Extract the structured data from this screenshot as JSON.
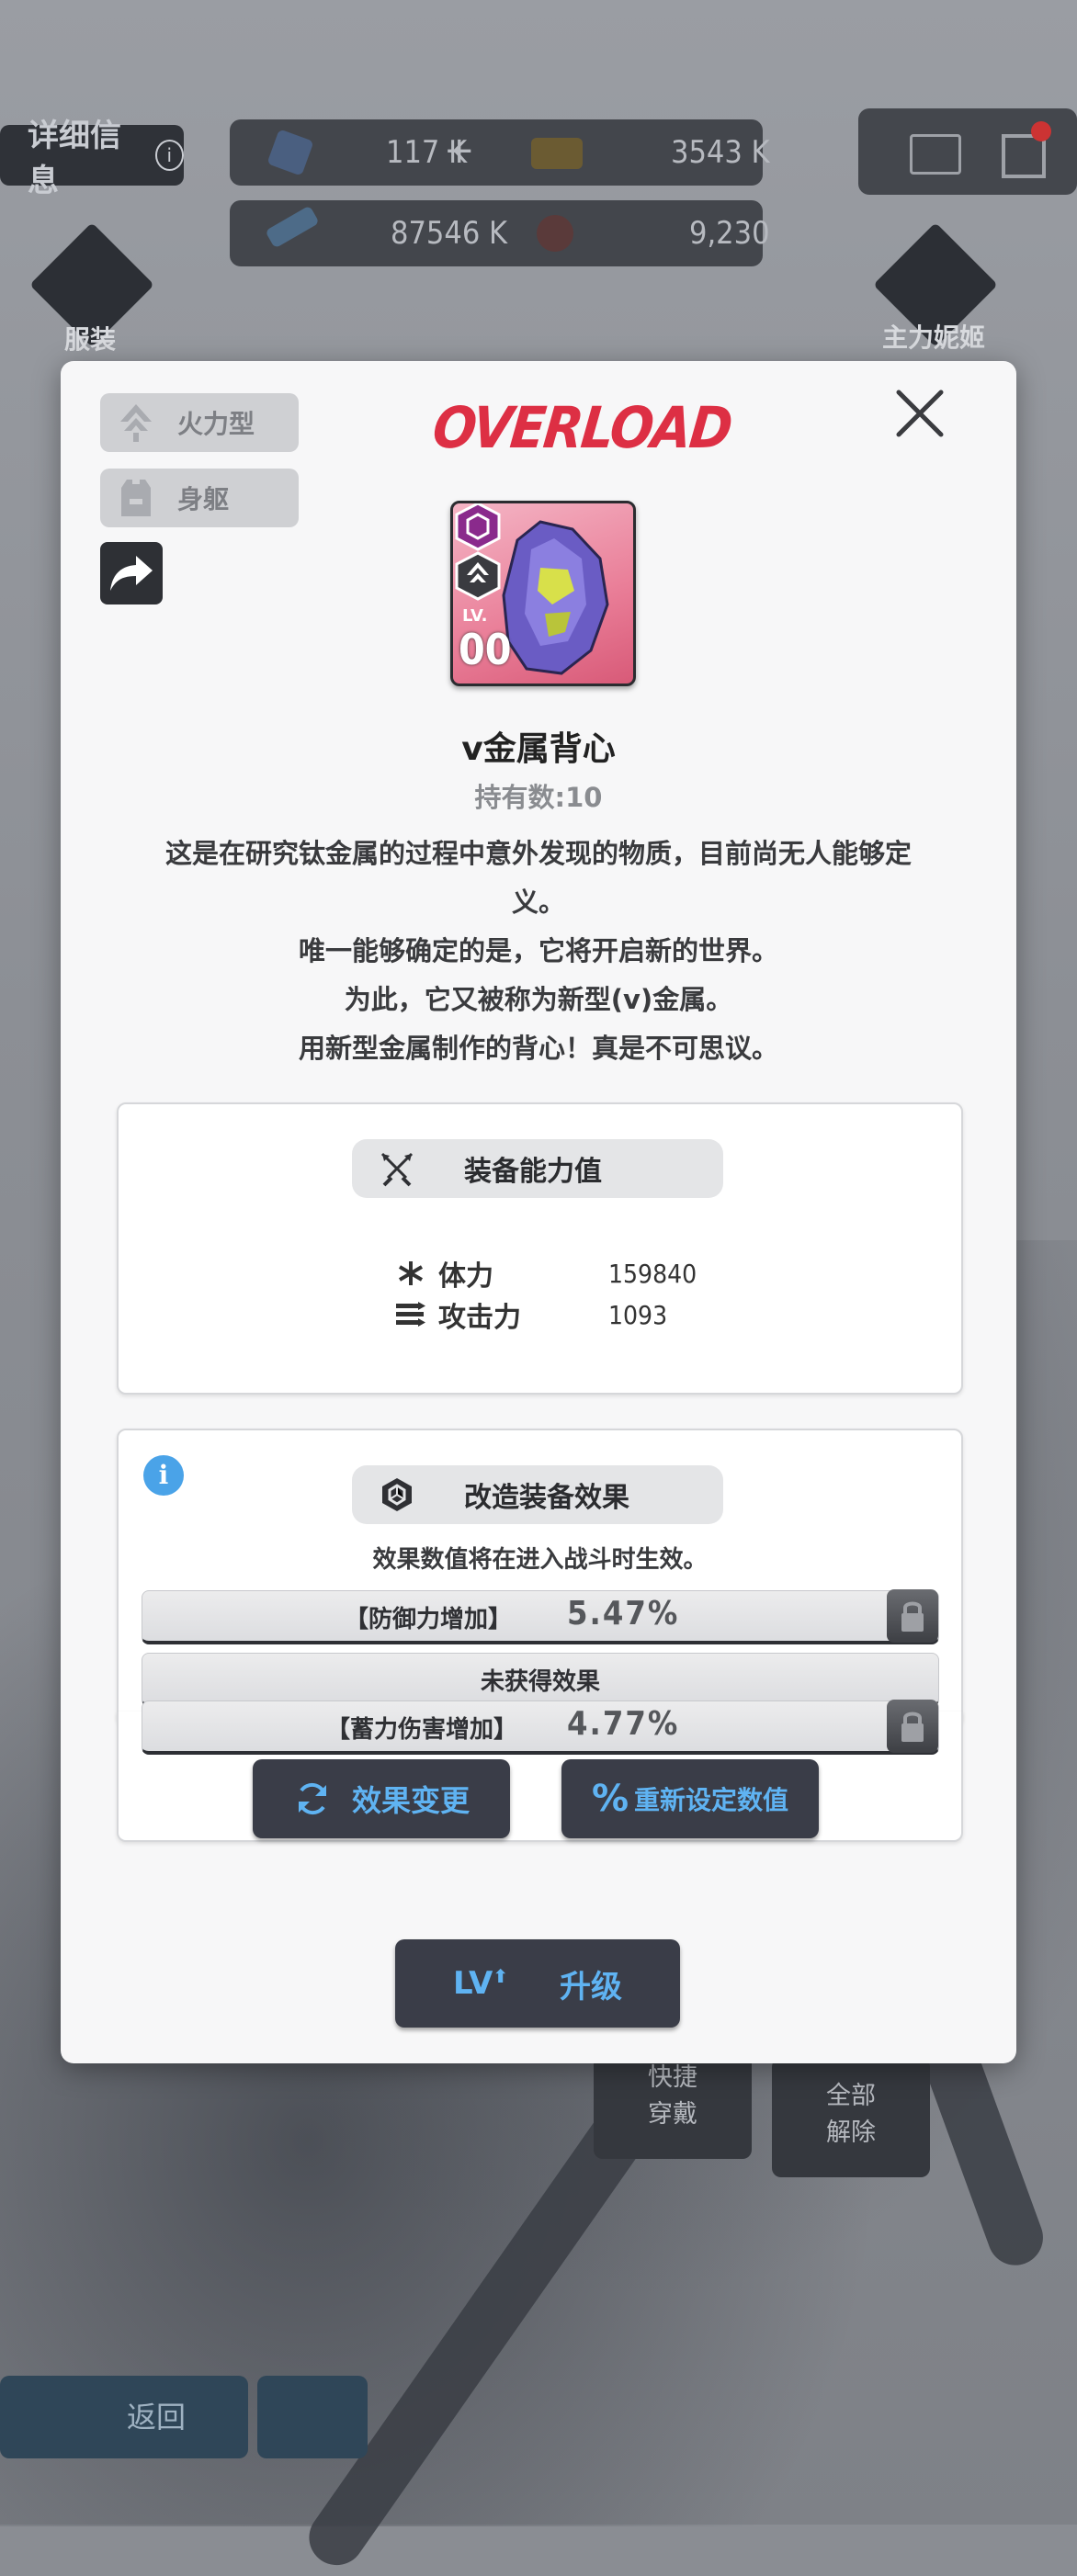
{
  "background": {
    "detail_info": "详细信息",
    "resources": [
      {
        "name": "diamond",
        "value": "117 K"
      },
      {
        "name": "card",
        "value": "3543 K"
      },
      {
        "name": "battery",
        "value": "87546 K"
      },
      {
        "name": "orb",
        "value": "9,230"
      }
    ],
    "costume_label": "服装",
    "main_nikke_label": "主力妮姬",
    "quick_equip": "快捷\n穿戴",
    "remove_all": "全部\n解除",
    "back_label": "返回"
  },
  "modal": {
    "chips": [
      {
        "label": "火力型",
        "icon": "firepower-icon"
      },
      {
        "label": "身躯",
        "icon": "body-armor-icon"
      }
    ],
    "logo": "OVERLOAD",
    "item": {
      "level_prefix": "LV.",
      "level": "00",
      "name": "v金属背心",
      "count": "持有数:10",
      "description": [
        "这是在研究钛金属的过程中意外发现的物质，目前尚无人能够定",
        "义。",
        "唯一能够确定的是，它将开启新的世界。",
        "为此，它又被称为新型(v)金属。",
        "用新型金属制作的背心！真是不可思议。"
      ]
    },
    "stats_panel": {
      "title": "装备能力值",
      "stats": [
        {
          "label": "体力",
          "value": "159840",
          "icon": "hp-icon"
        },
        {
          "label": "攻击力",
          "value": "1093",
          "icon": "attack-icon"
        }
      ]
    },
    "effects_panel": {
      "title": "改造装备效果",
      "note": "效果数值将在进入战斗时生效。",
      "effects": [
        {
          "name": "【防御力增加】",
          "value": "5.47%",
          "locked": true
        },
        {
          "name": "未获得效果",
          "value": "",
          "locked": false
        },
        {
          "name": "【蓄力伤害增加】",
          "value": "4.77%",
          "locked": true
        }
      ],
      "change_button": "效果变更",
      "reset_button": "重新设定数值"
    },
    "upgrade_button": {
      "prefix": "LV",
      "label": "升级"
    },
    "colors": {
      "accent_red": "#dd2f44",
      "accent_blue": "#5fb3f2",
      "info_blue": "#4aa3e8"
    }
  }
}
